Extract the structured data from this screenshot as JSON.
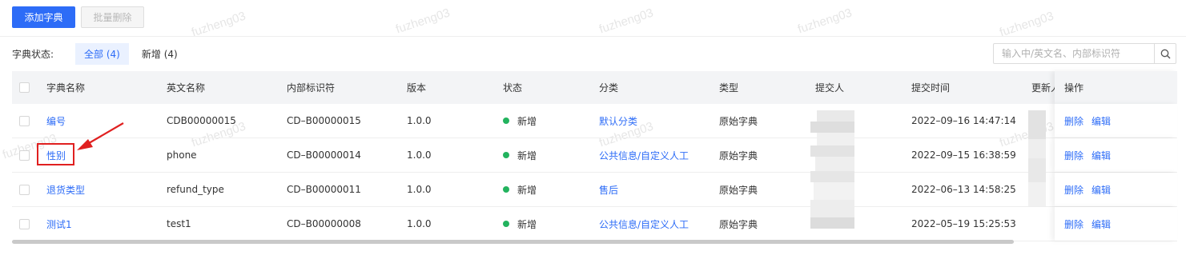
{
  "toolbar": {
    "add_label": "添加字典",
    "batch_delete_label": "批量删除"
  },
  "filter": {
    "label": "字典状态:",
    "tabs": [
      {
        "label": "全部 (4)",
        "active": true
      },
      {
        "label": "新增 (4)",
        "active": false
      }
    ]
  },
  "search": {
    "placeholder": "输入中/英文名、内部标识符"
  },
  "table": {
    "columns": [
      "字典名称",
      "英文名称",
      "内部标识符",
      "版本",
      "状态",
      "分类",
      "类型",
      "提交人",
      "提交时间",
      "更新人",
      "操作"
    ],
    "rows": [
      {
        "name": "编号",
        "english": "CDB00000015",
        "identifier": "CD–B00000015",
        "version": "1.0.0",
        "status": "新增",
        "category": "默认分类",
        "type": "原始字典",
        "submit_time": "2022–09–16 14:47:14"
      },
      {
        "name": "性别",
        "english": "phone",
        "identifier": "CD–B00000014",
        "version": "1.0.0",
        "status": "新增",
        "category": "公共信息/自定义人工",
        "type": "原始字典",
        "submit_time": "2022–09–15 16:38:59"
      },
      {
        "name": "退货类型",
        "english": "refund_type",
        "identifier": "CD–B00000011",
        "version": "1.0.0",
        "status": "新增",
        "category": "售后",
        "type": "原始字典",
        "submit_time": "2022–06–13 14:58:25"
      },
      {
        "name": "测试1",
        "english": "test1",
        "identifier": "CD–B00000008",
        "version": "1.0.0",
        "status": "新增",
        "category": "公共信息/自定义人工",
        "type": "原始字典",
        "submit_time": "2022–05–19 15:25:53"
      }
    ],
    "ops": {
      "delete": "删除",
      "edit": "编辑"
    },
    "colors": {
      "accent": "#2d6cf7",
      "status_green": "#23b35e",
      "annotation_red": "#e02020"
    }
  },
  "watermark": {
    "text": "fuzheng03"
  }
}
